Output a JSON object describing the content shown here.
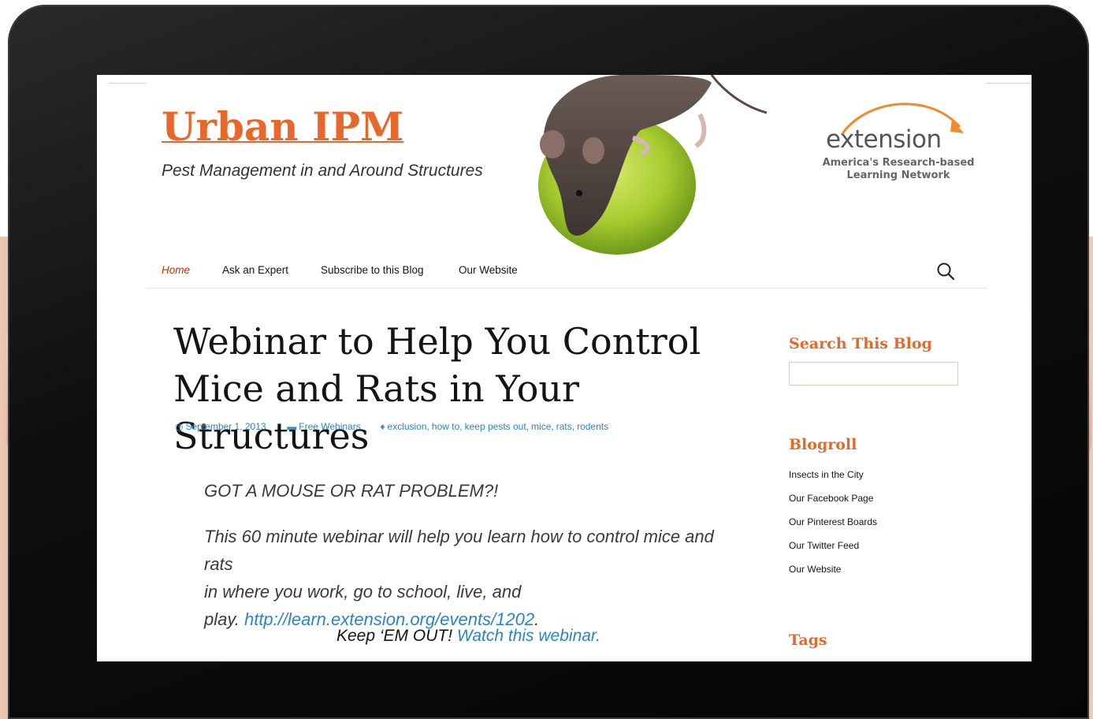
{
  "site": {
    "title": "Urban IPM",
    "description": "Pest Management in and Around Structures"
  },
  "logo": {
    "name": "extension",
    "tagline_line1": "America's Research-based",
    "tagline_line2": "Learning Network"
  },
  "nav": {
    "items": [
      {
        "label": "Home",
        "active": true
      },
      {
        "label": "Ask an Expert"
      },
      {
        "label": "Subscribe to this Blog"
      },
      {
        "label": "Our Website"
      }
    ],
    "search_icon": "search-icon"
  },
  "post": {
    "title_line1": "Webinar to Help You Control",
    "title_line2": "Mice and Rats in Your Structures",
    "date": "September 1, 2013",
    "category": "Free Webinars",
    "tags": [
      "exclusion",
      "how to",
      "keep pests out",
      "mice",
      "rats",
      "rodents"
    ],
    "heading": "GOT A MOUSE OR RAT PROBLEM?!",
    "body_line1": "This 60 minute webinar will help you learn how to control mice and rats",
    "body_line2": "in where you work, go to school, live, and",
    "body_line3_prefix": "play.",
    "body_link": "http://learn.extension.org/events/1202",
    "body_line3_suffix": ".",
    "keep_text": "Keep ‘EM OUT!",
    "keep_link": "Watch this webinar."
  },
  "sidebar": {
    "search_title": "Search This Blog",
    "search_value": "",
    "blogroll_title": "Blogroll",
    "blogroll": [
      "Insects in the City",
      "Our Facebook Page",
      "Our Pinterest Boards",
      "Our Twitter Feed",
      "Our Website"
    ],
    "tags_title": "Tags"
  },
  "colors": {
    "brand_orange": "#e8672a",
    "link_blue": "#2a85c2",
    "nav_active": "#bc360a"
  }
}
